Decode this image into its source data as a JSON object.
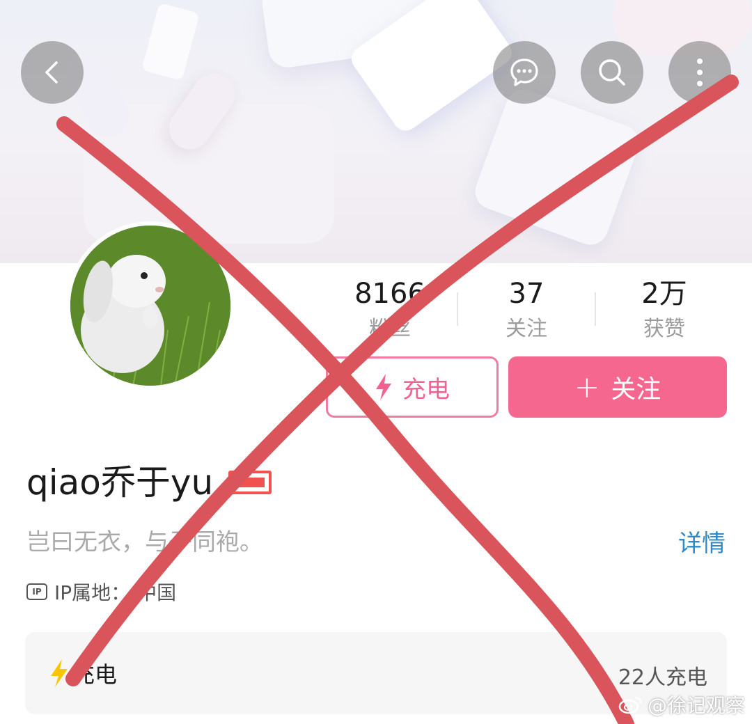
{
  "header": {
    "back_icon": "chevron-left-icon",
    "chat_icon": "chat-bubble-icon",
    "search_icon": "search-icon",
    "more_icon": "more-vertical-icon"
  },
  "profile": {
    "username": "qiao乔于yu",
    "signature": "岂曰无衣，与子同袍。",
    "details_label": "详情",
    "ip_label": "IP属地：",
    "ip_value": "中国"
  },
  "stats": [
    {
      "value": "8166",
      "label": "粉丝"
    },
    {
      "value": "37",
      "label": "关注"
    },
    {
      "value": "2万",
      "label": "获赞"
    }
  ],
  "actions": {
    "charge_label": "充电",
    "follow_label": "关注",
    "follow_plus": "+"
  },
  "charge_card": {
    "title": "充电",
    "count_text": "22人充电"
  },
  "watermark": "@徐记观察",
  "colors": {
    "accent_pink": "#f6678f",
    "link_blue": "#2e8bc7",
    "cross_red": "#d9555b",
    "bolt_yellow": "#f7c600"
  }
}
